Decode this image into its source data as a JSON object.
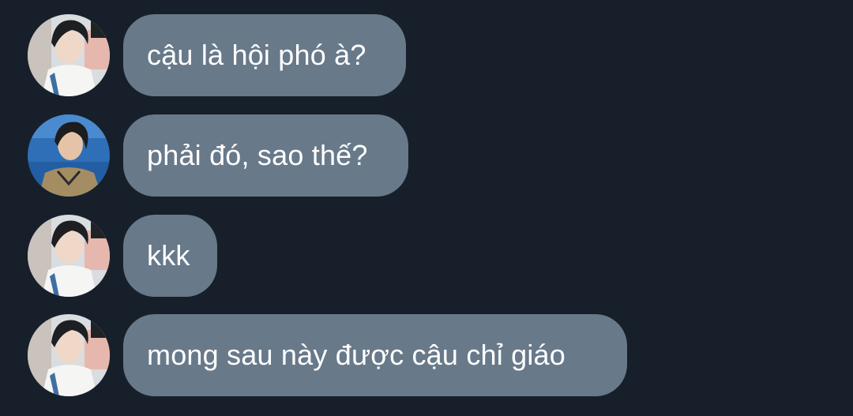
{
  "messages": [
    {
      "sender_avatar": "avatar-boy-white-shirt",
      "text": "cậu là hội phó à?"
    },
    {
      "sender_avatar": "avatar-boy-ocean-background",
      "text": "phải đó, sao thế?"
    },
    {
      "sender_avatar": "avatar-boy-white-shirt",
      "text": "kkk"
    },
    {
      "sender_avatar": "avatar-boy-white-shirt",
      "text": "mong sau này được cậu chỉ giáo"
    }
  ],
  "colors": {
    "background": "#17202a",
    "bubble": "#68798a",
    "text": "#ffffff"
  }
}
